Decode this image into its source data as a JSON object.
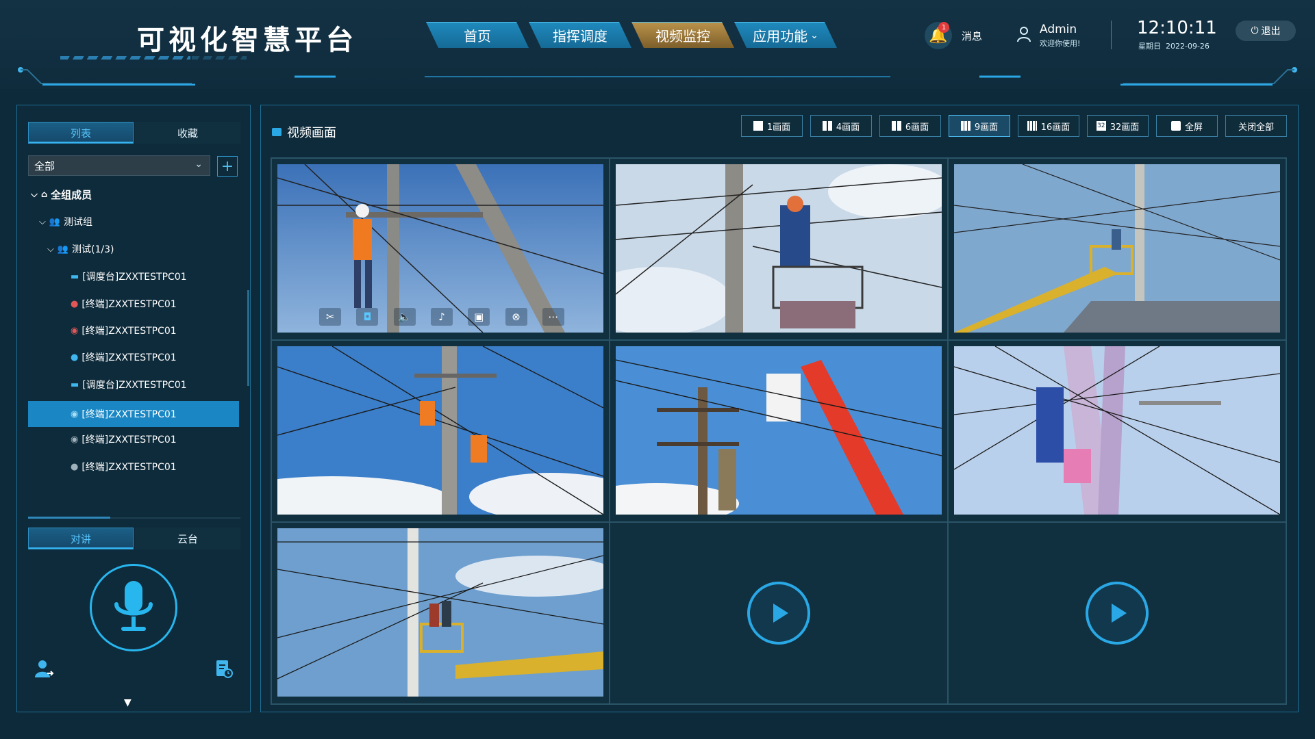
{
  "header": {
    "title": "可视化智慧平台",
    "nav": [
      {
        "label": "首页"
      },
      {
        "label": "指挥调度"
      },
      {
        "label": "视频监控",
        "active": true
      },
      {
        "label": "应用功能",
        "dropdown": true
      }
    ],
    "notification_count": "1",
    "message_label": "消息",
    "user_name": "Admin",
    "welcome": "欢迎你使用!",
    "time": "12:10:11",
    "weekday": "星期日",
    "date": "2022-09-26",
    "logout_label": "退出",
    "colors": {
      "nav": "#1a7db0",
      "nav_active": "#a07d3d",
      "accent": "#2aa8e6"
    }
  },
  "left_panel": {
    "tabs": [
      {
        "label": "列表",
        "active": true
      },
      {
        "label": "收藏"
      }
    ],
    "group_select": "全部",
    "tree": [
      {
        "label": "全组成员",
        "icon": "home-icon",
        "level": 0
      },
      {
        "label": "测试组",
        "icon": "group-icon",
        "level": 1
      },
      {
        "label": "测试(1/3)",
        "icon": "group-icon",
        "level": 2
      },
      {
        "label": "[调度台]ZXXTESTPC01",
        "icon": "monitor-icon",
        "level": 3
      },
      {
        "label": "[终端]ZXXTESTPC01",
        "icon": "user-icon",
        "level": 3
      },
      {
        "label": "[终端]ZXXTESTPC01",
        "icon": "location-icon",
        "level": 3
      },
      {
        "label": "[终端]ZXXTESTPC01",
        "icon": "user-icon",
        "level": 3
      },
      {
        "label": "[调度台]ZXXTESTPC01",
        "icon": "monitor-icon",
        "level": 3
      },
      {
        "label": "[终端]ZXXTESTPC01",
        "icon": "location-icon",
        "level": 3,
        "selected": true
      },
      {
        "label": "[终端]ZXXTESTPC01",
        "icon": "location-icon",
        "level": 3
      },
      {
        "label": "[终端]ZXXTESTPC01",
        "icon": "user-icon",
        "level": 3
      }
    ],
    "bottom_tabs": [
      {
        "label": "对讲",
        "active": true
      },
      {
        "label": "云台"
      }
    ]
  },
  "main": {
    "title": "视频画面",
    "layout_buttons": [
      {
        "label": "1画面"
      },
      {
        "label": "4画面"
      },
      {
        "label": "6画面"
      },
      {
        "label": "9画面",
        "active": true
      },
      {
        "label": "16画面"
      },
      {
        "label": "32画面"
      },
      {
        "label": "全屏"
      },
      {
        "label": "关闭全部"
      }
    ],
    "video_toolbar": [
      "scissors-icon",
      "camera-icon",
      "volume-icon",
      "mic-icon",
      "record-icon",
      "close-circle-icon",
      "more-icon"
    ],
    "cells": [
      {
        "scene": "video"
      },
      {
        "scene": "video"
      },
      {
        "scene": "video"
      },
      {
        "scene": "video"
      },
      {
        "scene": "video"
      },
      {
        "scene": "video"
      },
      {
        "scene": "video"
      },
      {
        "scene": "empty"
      },
      {
        "scene": "empty"
      }
    ]
  }
}
